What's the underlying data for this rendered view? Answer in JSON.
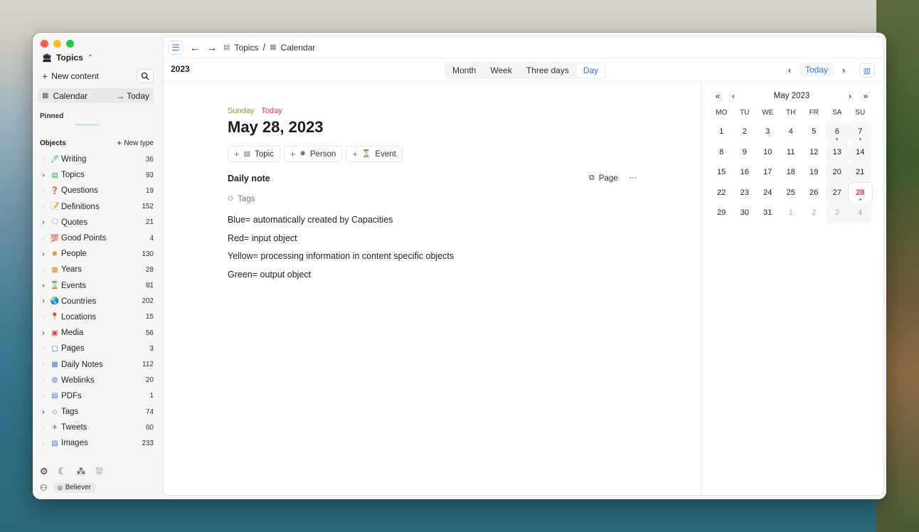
{
  "sidebar": {
    "space_icon": "🏛",
    "space_name": "Topics",
    "new_content": "New content",
    "calendar_label": "Calendar",
    "calendar_today": "Today",
    "pinned_label": "Pinned",
    "objects_label": "Objects",
    "new_type": "New type",
    "objects": [
      {
        "label": "Writing",
        "count": "36",
        "icon": "writing-icon",
        "glyph": "🖊",
        "color": "#3aa856",
        "expandable": false
      },
      {
        "label": "Topics",
        "count": "93",
        "icon": "topics-icon",
        "glyph": "▤",
        "color": "#3aa856",
        "expandable": true
      },
      {
        "label": "Questions",
        "count": "19",
        "icon": "question-icon",
        "glyph": "❓",
        "color": "#e0413f",
        "expandable": false
      },
      {
        "label": "Definitions",
        "count": "152",
        "icon": "definitions-icon",
        "glyph": "📝",
        "color": "#d4a017",
        "expandable": false
      },
      {
        "label": "Quotes",
        "count": "21",
        "icon": "quotes-icon",
        "glyph": "🗨",
        "color": "#4a7bd0",
        "expandable": true
      },
      {
        "label": "Good Points",
        "count": "4",
        "icon": "good-points-icon",
        "glyph": "💯",
        "color": "#e0413f",
        "expandable": false
      },
      {
        "label": "People",
        "count": "130",
        "icon": "people-icon",
        "glyph": "✺",
        "color": "#d88a1f",
        "expandable": true
      },
      {
        "label": "Years",
        "count": "28",
        "icon": "years-icon",
        "glyph": "▦",
        "color": "#d88a1f",
        "expandable": false
      },
      {
        "label": "Events",
        "count": "81",
        "icon": "events-icon",
        "glyph": "⌛",
        "color": "#b07a2a",
        "expandable": true
      },
      {
        "label": "Countries",
        "count": "202",
        "icon": "globe-icon",
        "glyph": "🌏",
        "color": "#2f7bd9",
        "expandable": true
      },
      {
        "label": "Locations",
        "count": "15",
        "icon": "pin-icon",
        "glyph": "📍",
        "color": "#e0413f",
        "expandable": false
      },
      {
        "label": "Media",
        "count": "56",
        "icon": "media-icon",
        "glyph": "▣",
        "color": "#e0413f",
        "expandable": true
      },
      {
        "label": "Pages",
        "count": "3",
        "icon": "pages-icon",
        "glyph": "▢",
        "color": "#4a7bd0",
        "expandable": false
      },
      {
        "label": "Daily Notes",
        "count": "112",
        "icon": "daily-notes-icon",
        "glyph": "▦",
        "color": "#4a7bd0",
        "expandable": false
      },
      {
        "label": "Weblinks",
        "count": "20",
        "icon": "weblinks-icon",
        "glyph": "◍",
        "color": "#4a7bd0",
        "expandable": false
      },
      {
        "label": "PDFs",
        "count": "1",
        "icon": "pdf-icon",
        "glyph": "▤",
        "color": "#4a7bd0",
        "expandable": false
      },
      {
        "label": "Tags",
        "count": "74",
        "icon": "tag-icon",
        "glyph": "⬦",
        "color": "#4a7bd0",
        "expandable": true
      },
      {
        "label": "Tweets",
        "count": "60",
        "icon": "tweet-icon",
        "glyph": "✈",
        "color": "#4a7bd0",
        "expandable": false
      },
      {
        "label": "Images",
        "count": "233",
        "icon": "images-icon",
        "glyph": "▨",
        "color": "#4a7bd0",
        "expandable": false
      }
    ],
    "user_name": "Believer"
  },
  "topbar": {
    "breadcrumb": [
      "Topics",
      "Calendar"
    ]
  },
  "calendar": {
    "year": "2023",
    "views": [
      "Month",
      "Week",
      "Three days",
      "Day"
    ],
    "active_view": "Day",
    "today_btn": "Today"
  },
  "day": {
    "weekday": "Sunday",
    "today_tag": "Today",
    "date_title": "May 28, 2023",
    "add_buttons": [
      "Topic",
      "Person",
      "Event"
    ],
    "note_title": "Daily note",
    "page_btn": "Page",
    "more_btn": "···",
    "tags_label": "Tags",
    "lines": [
      "Blue= automatically created by Capacities",
      "Red= input object",
      "Yellow= processing information in content specific objects",
      "Green= output object"
    ]
  },
  "mini_calendar": {
    "title": "May 2023",
    "weekdays": [
      "MO",
      "TU",
      "WE",
      "TH",
      "FR",
      "SA",
      "SU"
    ],
    "days": [
      {
        "d": "1"
      },
      {
        "d": "2"
      },
      {
        "d": "3"
      },
      {
        "d": "4"
      },
      {
        "d": "5"
      },
      {
        "d": "6",
        "dot": true
      },
      {
        "d": "7",
        "dot": true
      },
      {
        "d": "8"
      },
      {
        "d": "9"
      },
      {
        "d": "10"
      },
      {
        "d": "11"
      },
      {
        "d": "12"
      },
      {
        "d": "13"
      },
      {
        "d": "14"
      },
      {
        "d": "15"
      },
      {
        "d": "16"
      },
      {
        "d": "17"
      },
      {
        "d": "18"
      },
      {
        "d": "19"
      },
      {
        "d": "20"
      },
      {
        "d": "21"
      },
      {
        "d": "22"
      },
      {
        "d": "23"
      },
      {
        "d": "24"
      },
      {
        "d": "25"
      },
      {
        "d": "26"
      },
      {
        "d": "27"
      },
      {
        "d": "28",
        "dot": true,
        "selected": true
      },
      {
        "d": "29"
      },
      {
        "d": "30"
      },
      {
        "d": "31"
      },
      {
        "d": "1",
        "faint": true
      },
      {
        "d": "2",
        "faint": true
      },
      {
        "d": "3",
        "faint": true
      },
      {
        "d": "4",
        "faint": true
      }
    ]
  },
  "colors": {
    "accent": "#2f7bd9",
    "weekday_green": "#6cb52f",
    "today_red": "#e0413f"
  }
}
